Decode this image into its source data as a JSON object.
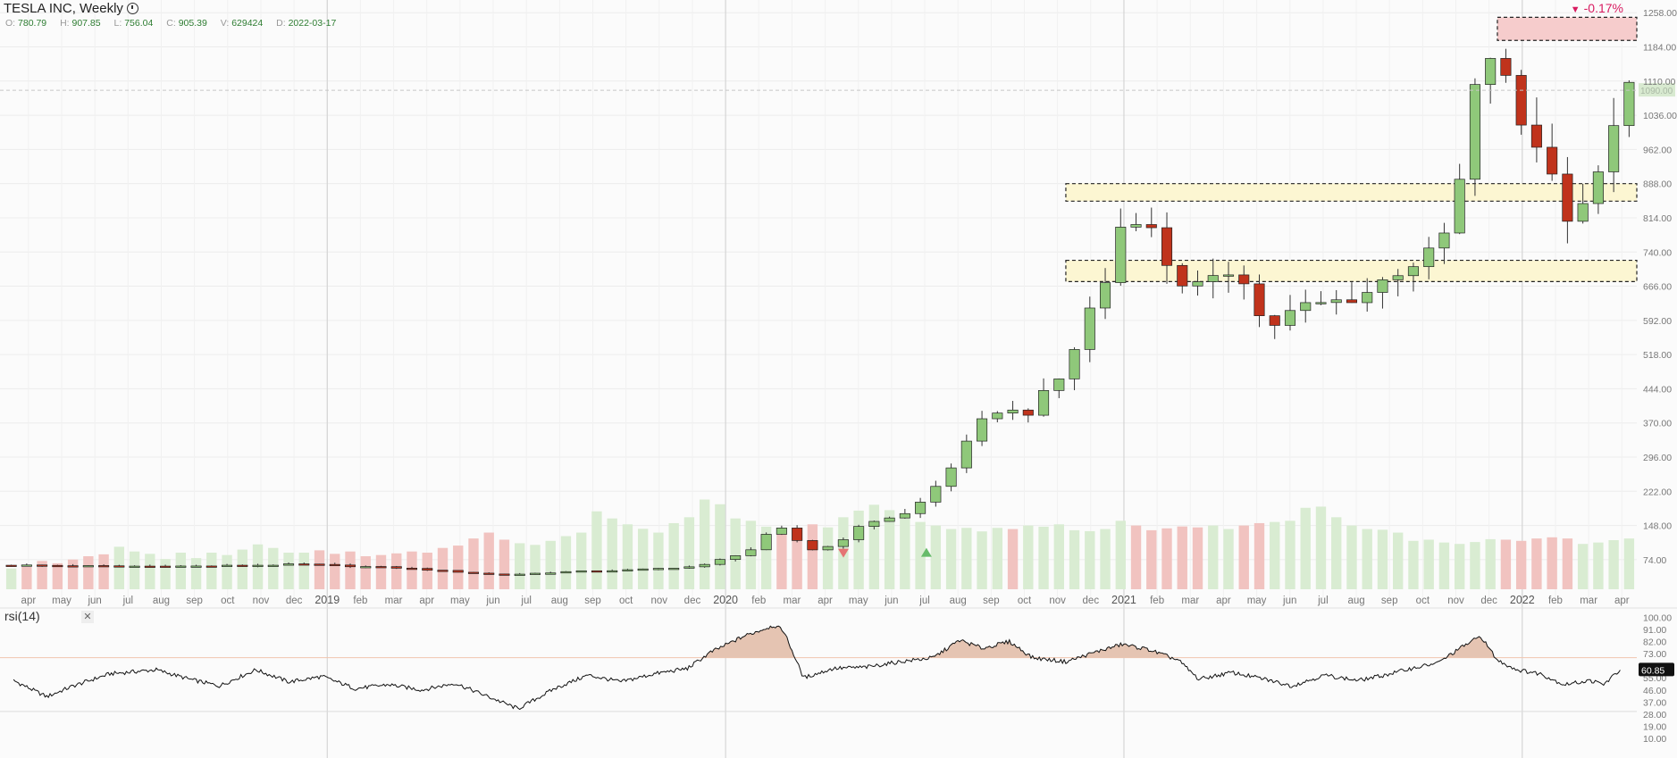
{
  "header": {
    "title": "TESLA INC, Weekly",
    "ohlc": [
      {
        "k": "O:",
        "v": "780.79"
      },
      {
        "k": "H:",
        "v": "907.85"
      },
      {
        "k": "L:",
        "v": "756.04"
      },
      {
        "k": "C:",
        "v": "905.39"
      },
      {
        "k": "V:",
        "v": "629424"
      },
      {
        "k": "D:",
        "v": "2022-03-17"
      }
    ]
  },
  "change_badge": "-0.17%",
  "rsi_label": "rsi(14)",
  "colors": {
    "up": "#8fc87a",
    "down": "#c0331c",
    "vol_up": "#d9ecd2",
    "vol_down": "#f1c3c0",
    "zone_red": "#f6cccc",
    "zone_yellow": "#fcf6d2",
    "rsi_fill": "#e5c4b2",
    "grid": "#ececec",
    "axis_text": "#777777",
    "accent": "#d81b60"
  },
  "chart_data": [
    {
      "type": "candlestick",
      "title": "TESLA INC, Weekly",
      "y_axis": {
        "ticks": [
          "1258.00",
          "1184.00",
          "1110.00",
          "1036.00",
          "962.00",
          "888.00",
          "814.00",
          "740.00",
          "666.00",
          "592.00",
          "518.00",
          "444.00",
          "370.00",
          "296.00",
          "222.00",
          "148.00",
          "74.00"
        ],
        "range": [
          10,
          1270
        ]
      },
      "last_price_label": "1090.00",
      "x_axis": {
        "labels": [
          {
            "t": "apr",
            "m": 0.75
          },
          {
            "t": "may",
            "m": 1.75
          },
          {
            "t": "jun",
            "m": 2.75
          },
          {
            "t": "jul",
            "m": 3.75
          },
          {
            "t": "aug",
            "m": 4.75
          },
          {
            "t": "sep",
            "m": 5.75
          },
          {
            "t": "oct",
            "m": 6.75
          },
          {
            "t": "nov",
            "m": 7.75
          },
          {
            "t": "dec",
            "m": 8.75
          },
          {
            "t": "2019",
            "m": 9.75
          },
          {
            "t": "feb",
            "m": 10.75
          },
          {
            "t": "mar",
            "m": 11.75
          },
          {
            "t": "apr",
            "m": 12.75
          },
          {
            "t": "may",
            "m": 13.75
          },
          {
            "t": "jun",
            "m": 14.75
          },
          {
            "t": "jul",
            "m": 15.75
          },
          {
            "t": "aug",
            "m": 16.75
          },
          {
            "t": "sep",
            "m": 17.75
          },
          {
            "t": "oct",
            "m": 18.75
          },
          {
            "t": "nov",
            "m": 19.75
          },
          {
            "t": "dec",
            "m": 20.75
          },
          {
            "t": "2020",
            "m": 21.75
          },
          {
            "t": "feb",
            "m": 22.75
          },
          {
            "t": "mar",
            "m": 23.75
          },
          {
            "t": "apr",
            "m": 24.75
          },
          {
            "t": "may",
            "m": 25.75
          },
          {
            "t": "jun",
            "m": 26.75
          },
          {
            "t": "jul",
            "m": 27.75
          },
          {
            "t": "aug",
            "m": 28.75
          },
          {
            "t": "sep",
            "m": 29.75
          },
          {
            "t": "oct",
            "m": 30.75
          },
          {
            "t": "nov",
            "m": 31.75
          },
          {
            "t": "dec",
            "m": 32.75
          },
          {
            "t": "2021",
            "m": 33.75
          },
          {
            "t": "feb",
            "m": 34.75
          },
          {
            "t": "mar",
            "m": 35.75
          },
          {
            "t": "apr",
            "m": 36.75
          },
          {
            "t": "may",
            "m": 37.75
          },
          {
            "t": "jun",
            "m": 38.75
          },
          {
            "t": "jul",
            "m": 39.75
          },
          {
            "t": "aug",
            "m": 40.75
          },
          {
            "t": "sep",
            "m": 41.75
          },
          {
            "t": "oct",
            "m": 42.75
          },
          {
            "t": "nov",
            "m": 43.75
          },
          {
            "t": "dec",
            "m": 44.75
          },
          {
            "t": "2022",
            "m": 45.75
          },
          {
            "t": "feb",
            "m": 46.75
          },
          {
            "t": "mar",
            "m": 47.75
          },
          {
            "t": "apr",
            "m": 48.75
          }
        ]
      },
      "zones": [
        {
          "kind": "resistance",
          "low": 1198,
          "high": 1248,
          "color": "red"
        },
        {
          "kind": "support",
          "low": 850,
          "high": 888,
          "color": "yellow"
        },
        {
          "kind": "support",
          "low": 676,
          "high": 722,
          "color": "yellow"
        }
      ],
      "anchors": [
        [
          0.5,
          62
        ],
        [
          3,
          60
        ],
        [
          6,
          60
        ],
        [
          9,
          64
        ],
        [
          12,
          56
        ],
        [
          15,
          41
        ],
        [
          17,
          48
        ],
        [
          19,
          52
        ],
        [
          21,
          60
        ],
        [
          22.5,
          95
        ],
        [
          23.3,
          147
        ],
        [
          24.3,
          95
        ],
        [
          25,
          105
        ],
        [
          26,
          155
        ],
        [
          27.3,
          175
        ],
        [
          28,
          225
        ],
        [
          28.7,
          290
        ],
        [
          29.3,
          355
        ],
        [
          29.8,
          400
        ],
        [
          30.8,
          390
        ],
        [
          32,
          480
        ],
        [
          32.6,
          600
        ],
        [
          33.3,
          690
        ],
        [
          33.8,
          840
        ],
        [
          34.5,
          795
        ],
        [
          35.3,
          680
        ],
        [
          36.2,
          660
        ],
        [
          37.2,
          715
        ],
        [
          38,
          570
        ],
        [
          39,
          620
        ],
        [
          40,
          630
        ],
        [
          41,
          650
        ],
        [
          42,
          700
        ],
        [
          43,
          735
        ],
        [
          43.7,
          808
        ],
        [
          44,
          960
        ],
        [
          44.5,
          1150
        ],
        [
          45,
          1180
        ],
        [
          45.5,
          1030
        ],
        [
          46,
          1000
        ],
        [
          46.5,
          940
        ],
        [
          47,
          820
        ],
        [
          47.5,
          845
        ],
        [
          48,
          885
        ],
        [
          48.4,
          1000
        ],
        [
          48.7,
          1085
        ]
      ],
      "volume_axis_max": 450,
      "volume": [
        88,
        95,
        120,
        110,
        126,
        140,
        148,
        180,
        160,
        150,
        128,
        155,
        132,
        155,
        145,
        168,
        190,
        175,
        155,
        155,
        165,
        150,
        160,
        140,
        145,
        152,
        160,
        155,
        175,
        185,
        215,
        240,
        210,
        195,
        188,
        205,
        225,
        240,
        330,
        300,
        275,
        256,
        240,
        280,
        305,
        380,
        360,
        300,
        290,
        265,
        240,
        260,
        275,
        262,
        305,
        333,
        358,
        335,
        300,
        285,
        270,
        255,
        260,
        245,
        260,
        255,
        270,
        265,
        275,
        250,
        246,
        255,
        290,
        270,
        250,
        258,
        266,
        262,
        270,
        255,
        270,
        280,
        285,
        290,
        345,
        350,
        305,
        270,
        255,
        252,
        240,
        205,
        210,
        198,
        192,
        200,
        212,
        210,
        205,
        215,
        220,
        215,
        192,
        198,
        208,
        215
      ],
      "markers": [
        {
          "kind": "down-triangle",
          "m": 25.3,
          "price": 88
        },
        {
          "kind": "up-triangle",
          "m": 27.8,
          "price": 90
        }
      ]
    },
    {
      "type": "line",
      "title": "rsi(14)",
      "y_axis": {
        "ticks": [
          "100.00",
          "91.00",
          "82.00",
          "73.00",
          "64.00",
          "55.00",
          "46.00",
          "37.00",
          "28.00",
          "19.00",
          "10.00"
        ],
        "range": [
          6,
          101
        ]
      },
      "overbought_level": 70,
      "last_value": "60.85",
      "anchors": [
        [
          0.3,
          53
        ],
        [
          1.3,
          41
        ],
        [
          2.1,
          49
        ],
        [
          3.2,
          58
        ],
        [
          4.6,
          61
        ],
        [
          5.6,
          54
        ],
        [
          6.5,
          49
        ],
        [
          7.6,
          61
        ],
        [
          8.6,
          52
        ],
        [
          9.6,
          56
        ],
        [
          10.6,
          47
        ],
        [
          11.6,
          50
        ],
        [
          12.6,
          46
        ],
        [
          13.6,
          51
        ],
        [
          14.6,
          41
        ],
        [
          15.5,
          32
        ],
        [
          16.6,
          47
        ],
        [
          17.6,
          57
        ],
        [
          18.6,
          52
        ],
        [
          19.6,
          58
        ],
        [
          20.6,
          62
        ],
        [
          21.3,
          74
        ],
        [
          22.3,
          86
        ],
        [
          23.2,
          94
        ],
        [
          23.5,
          90
        ],
        [
          24.1,
          55
        ],
        [
          25,
          62
        ],
        [
          26,
          63
        ],
        [
          27,
          67
        ],
        [
          28,
          70
        ],
        [
          28.8,
          83
        ],
        [
          29.5,
          77
        ],
        [
          30.3,
          82
        ],
        [
          31,
          70
        ],
        [
          32,
          67
        ],
        [
          33,
          75
        ],
        [
          33.7,
          80
        ],
        [
          34.5,
          76
        ],
        [
          35.4,
          68
        ],
        [
          36,
          54
        ],
        [
          37,
          59
        ],
        [
          38,
          54
        ],
        [
          38.8,
          49
        ],
        [
          39.8,
          57
        ],
        [
          40.8,
          53
        ],
        [
          41.6,
          57
        ],
        [
          42.4,
          62
        ],
        [
          43.2,
          66
        ],
        [
          44,
          79
        ],
        [
          44.5,
          86
        ],
        [
          45,
          68
        ],
        [
          45.6,
          61
        ],
        [
          46.3,
          58
        ],
        [
          47,
          50
        ],
        [
          47.8,
          53
        ],
        [
          48.2,
          50
        ],
        [
          48.7,
          61
        ]
      ]
    }
  ]
}
